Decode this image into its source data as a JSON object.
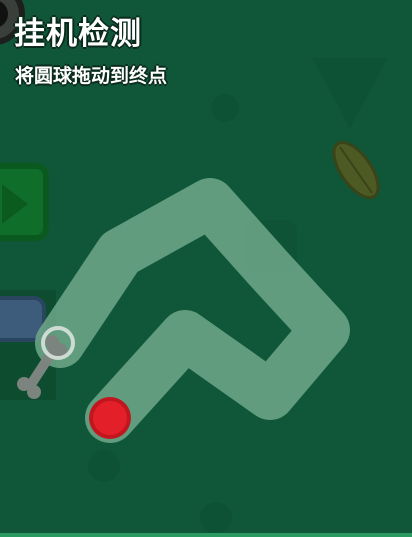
{
  "game": {
    "title": "挂机检测",
    "instruction": "将圆球拖动到终点"
  },
  "colors": {
    "background": "#10573a",
    "track": "#6fa88a",
    "ball": "#e3202a",
    "goal_ring": "#d9e3dd"
  },
  "decorations": [
    "circle-decoration",
    "triangle-decoration",
    "leaf-icon",
    "play-arrow-icon",
    "blue-pill-icon",
    "bone-icon"
  ]
}
